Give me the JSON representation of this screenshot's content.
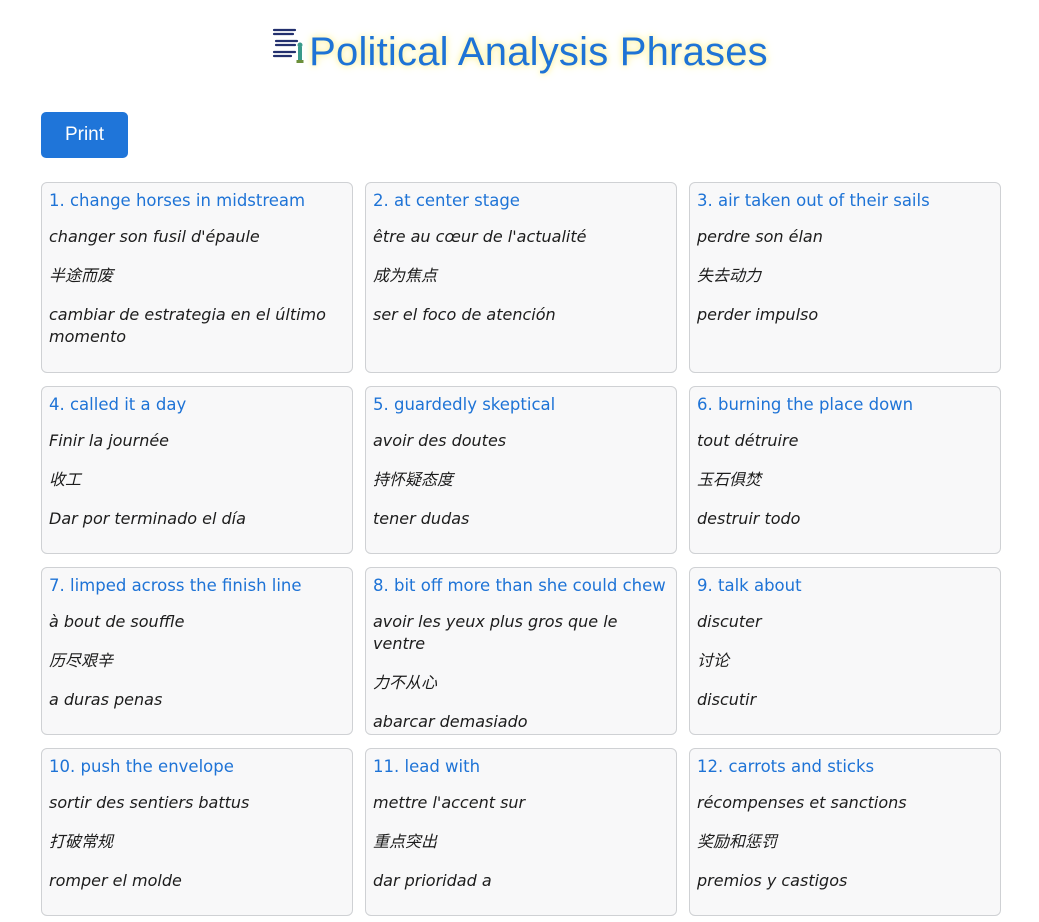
{
  "header": {
    "title": "Political Analysis Phrases",
    "logo_text": "Political Analysis Phrases"
  },
  "toolbar": {
    "print_label": "Print"
  },
  "colors": {
    "accent": "#1e73d6",
    "button_bg": "#1f75d9",
    "card_bg": "#f8f8f9",
    "card_border": "#cfd1d4",
    "title_glow": "#fff39a"
  },
  "cards": [
    {
      "title": "1. change horses in midstream",
      "fr": "changer son fusil d'épaule",
      "zh": "半途而废",
      "es": "cambiar de estrategia en el último momento"
    },
    {
      "title": "2. at center stage",
      "fr": "être au cœur de l'actualité",
      "zh": "成为焦点",
      "es": "ser el foco de atención"
    },
    {
      "title": "3. air taken out of their sails",
      "fr": "perdre son élan",
      "zh": "失去动力",
      "es": "perder impulso"
    },
    {
      "title": "4. called it a day",
      "fr": "Finir la journée",
      "zh": "收工",
      "es": "Dar por terminado el día"
    },
    {
      "title": "5. guardedly skeptical",
      "fr": "avoir des doutes",
      "zh": "持怀疑态度",
      "es": "tener dudas"
    },
    {
      "title": "6. burning the place down",
      "fr": "tout détruire",
      "zh": "玉石俱焚",
      "es": "destruir todo"
    },
    {
      "title": "7. limped across the finish line",
      "fr": "à bout de souffle",
      "zh": "历尽艰辛",
      "es": "a duras penas"
    },
    {
      "title": "8. bit off more than she could chew",
      "fr": "avoir les yeux plus gros que le ventre",
      "zh": "力不从心",
      "es": "abarcar demasiado"
    },
    {
      "title": "9. talk about",
      "fr": "discuter",
      "zh": "讨论",
      "es": "discutir"
    },
    {
      "title": "10. push the envelope",
      "fr": "sortir des sentiers battus",
      "zh": "打破常规",
      "es": "romper el molde"
    },
    {
      "title": "11. lead with",
      "fr": "mettre l'accent sur",
      "zh": "重点突出",
      "es": "dar prioridad a"
    },
    {
      "title": "12. carrots and sticks",
      "fr": "récompenses et sanctions",
      "zh": "奖励和惩罚",
      "es": "premios y castigos"
    }
  ]
}
